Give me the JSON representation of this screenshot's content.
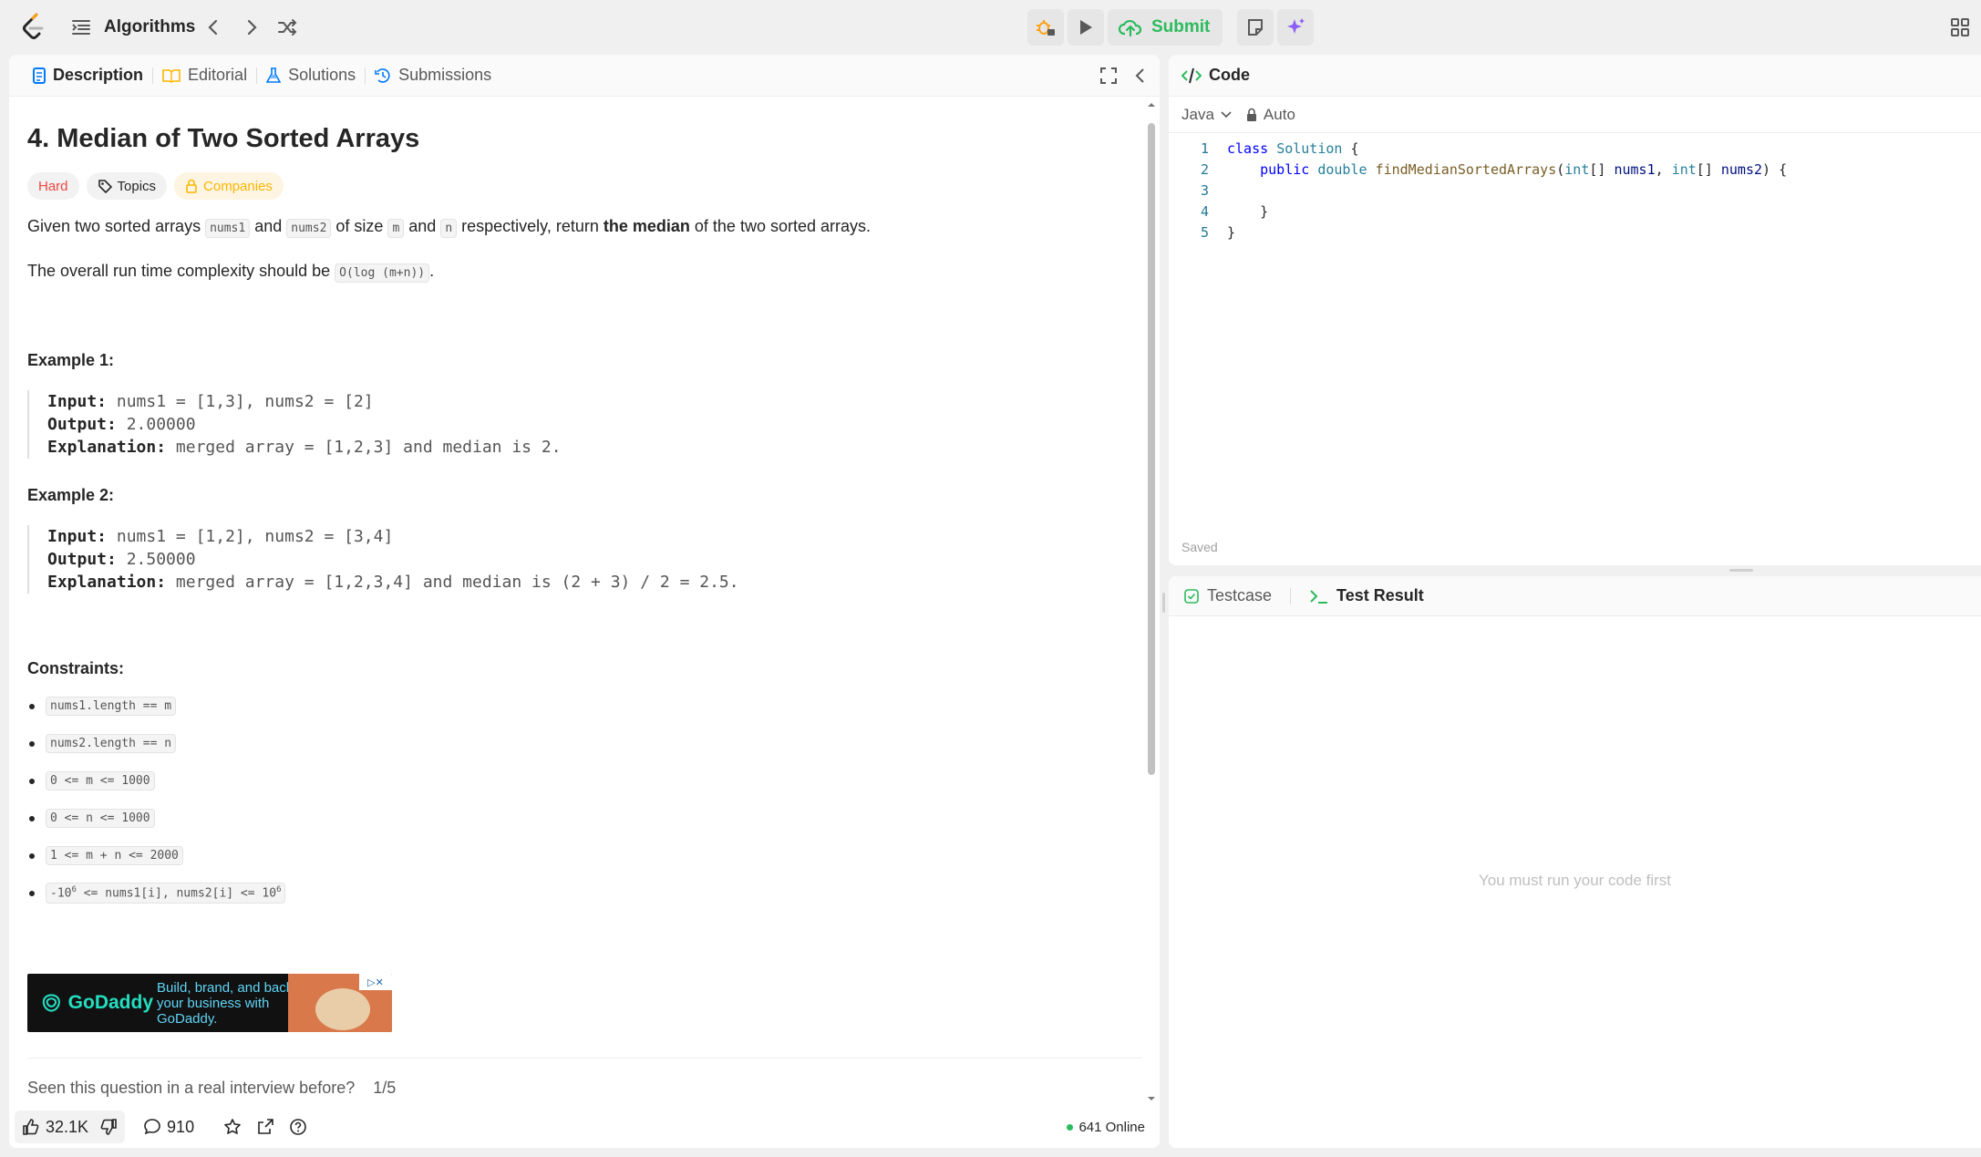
{
  "nav": {
    "problem_list_label": "Algorithms",
    "submit_label": "Submit"
  },
  "colors": {
    "accent_green": "#2cbb5d",
    "hard": "#ef4743",
    "companies": "#ffb700",
    "ai_purple": "#8b5cf6"
  },
  "left_tabs": [
    {
      "label": "Description",
      "icon": "description-icon"
    },
    {
      "label": "Editorial",
      "icon": "book-icon"
    },
    {
      "label": "Solutions",
      "icon": "flask-icon"
    },
    {
      "label": "Submissions",
      "icon": "history-icon"
    }
  ],
  "problem": {
    "title": "4. Median of Two Sorted Arrays",
    "difficulty": "Hard",
    "topics_label": "Topics",
    "companies_label": "Companies",
    "desc": {
      "t1": "Given two sorted arrays ",
      "c1": "nums1",
      "t2": " and ",
      "c2": "nums2",
      "t3": " of size ",
      "c3": "m",
      "t4": " and ",
      "c4": "n",
      "t5": " respectively, return ",
      "bold": "the median",
      "t6": " of the two sorted arrays."
    },
    "complexity": {
      "text": "The overall run time complexity should be ",
      "code": "O(log (m+n))",
      "end": "."
    },
    "examples": [
      {
        "title": "Example 1:",
        "input_label": "Input:",
        "input": "nums1 = [1,3], nums2 = [2]",
        "output_label": "Output:",
        "output": "2.00000",
        "expl_label": "Explanation:",
        "expl": "merged array = [1,2,3] and median is 2."
      },
      {
        "title": "Example 2:",
        "input_label": "Input:",
        "input": "nums1 = [1,2], nums2 = [3,4]",
        "output_label": "Output:",
        "output": "2.50000",
        "expl_label": "Explanation:",
        "expl": "merged array = [1,2,3,4] and median is (2 + 3) / 2 = 2.5."
      }
    ],
    "constraints_title": "Constraints:",
    "constraints": [
      "nums1.length == m",
      "nums2.length == n",
      "0 <= m <= 1000",
      "0 <= n <= 1000",
      "1 <= m + n <= 2000"
    ],
    "constraint_last": {
      "a": "-10",
      "sup1": "6",
      "b": " <= nums1[i], nums2[i] <= 10",
      "sup2": "6"
    }
  },
  "ad": {
    "brand": "GoDaddy",
    "text": "Build, brand, and back your business with GoDaddy."
  },
  "interview": {
    "question": "Seen this question in a real interview before?",
    "progress": "1/5"
  },
  "footer": {
    "likes": "32.1K",
    "comments": "910",
    "online": "641 Online"
  },
  "code_panel": {
    "title": "Code",
    "language": "Java",
    "autocomplete": "Auto",
    "saved": "Saved"
  },
  "result_panel": {
    "testcase_tab": "Testcase",
    "result_tab": "Test Result",
    "empty": "You must run your code first"
  }
}
